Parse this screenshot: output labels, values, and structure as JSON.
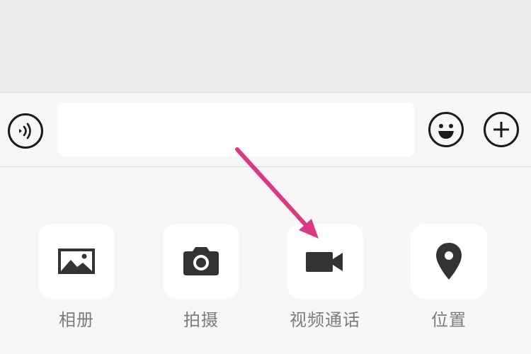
{
  "input_bar": {
    "voice_icon": "voice-wave-icon",
    "text_value": "",
    "emoji_icon": "smiley-icon",
    "more_icon": "plus-icon"
  },
  "actions": [
    {
      "label": "相册",
      "icon": "photo-album-icon"
    },
    {
      "label": "拍摄",
      "icon": "camera-icon"
    },
    {
      "label": "视频通话",
      "icon": "video-camera-icon"
    },
    {
      "label": "位置",
      "icon": "location-pin-icon"
    }
  ],
  "colors": {
    "icon": "#333333",
    "label": "#7c7c7c",
    "annotation_arrow": "#d93a82"
  }
}
